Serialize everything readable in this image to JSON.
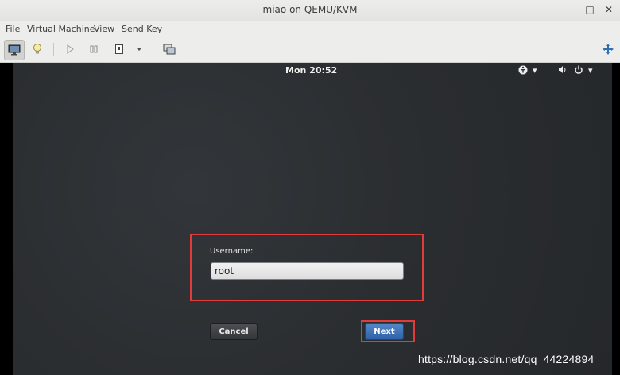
{
  "window": {
    "title": "miao on QEMU/KVM",
    "minimize": "–",
    "maximize": "□",
    "close": "✕"
  },
  "menu": [
    "File",
    "Virtual Machine",
    "View",
    "Send Key"
  ],
  "guest": {
    "clock": "Mon 20:52",
    "login": {
      "username_label": "Username:",
      "username_value": "root",
      "cancel_label": "Cancel",
      "next_label": "Next"
    }
  },
  "watermark": "https://blog.csdn.net/qq_44224894",
  "colors": {
    "highlight": "#e33a3a",
    "next_button": "#3a6fb5",
    "guest_bg": "#2c2f32"
  }
}
